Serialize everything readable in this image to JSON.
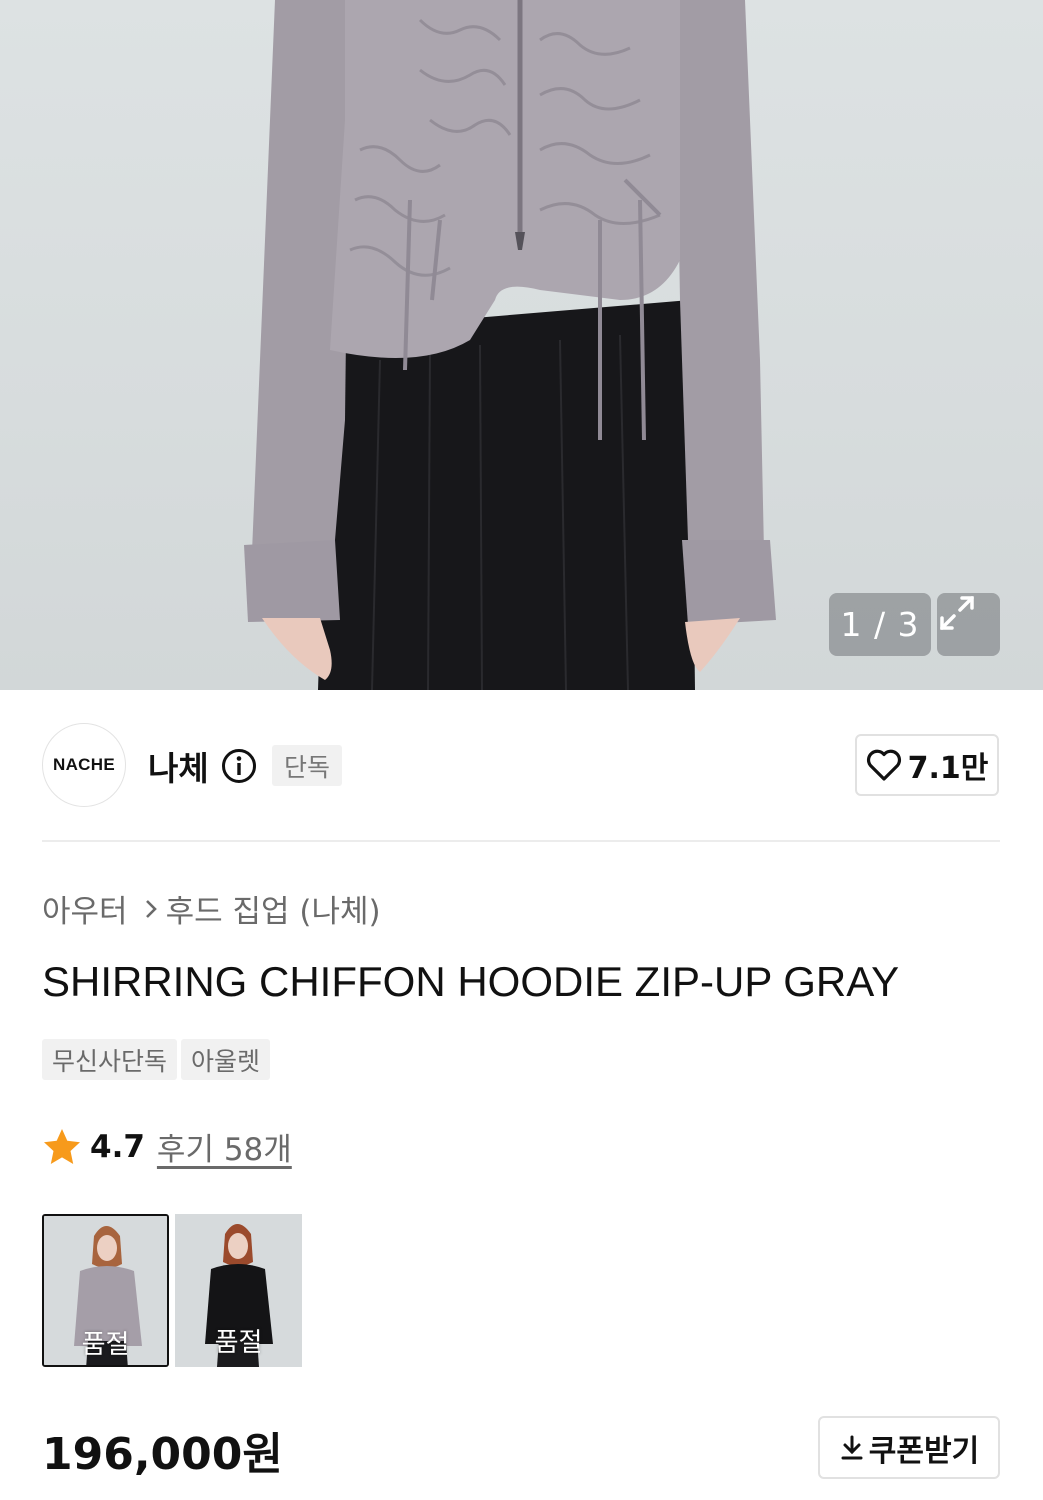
{
  "gallery": {
    "counter": "1 / 3",
    "expand_icon": "expand-icon"
  },
  "brand": {
    "logo_text": "NACHE",
    "name": "나체",
    "info_icon": "info-icon",
    "badge": "단독",
    "likes": "7.1만",
    "like_icon": "heart-outline-icon"
  },
  "breadcrumb": {
    "category": "아우터",
    "separator_icon": "chevron-right-icon",
    "subcategory": "후드 집업 (나체)"
  },
  "product": {
    "title": "SHIRRING CHIFFON HOODIE ZIP-UP GRAY",
    "tags": [
      "무신사단독",
      "아울렛"
    ],
    "rating": "4.7",
    "rating_icon": "star-icon",
    "review_link": "후기 58개",
    "star_color": "#F79A1B",
    "swatches": [
      {
        "color": "gray",
        "status": "품절",
        "selected": true
      },
      {
        "color": "black",
        "status": "품절",
        "selected": false
      }
    ],
    "price": "196,000원",
    "coupon_label": "쿠폰받기",
    "coupon_icon": "download-icon"
  }
}
